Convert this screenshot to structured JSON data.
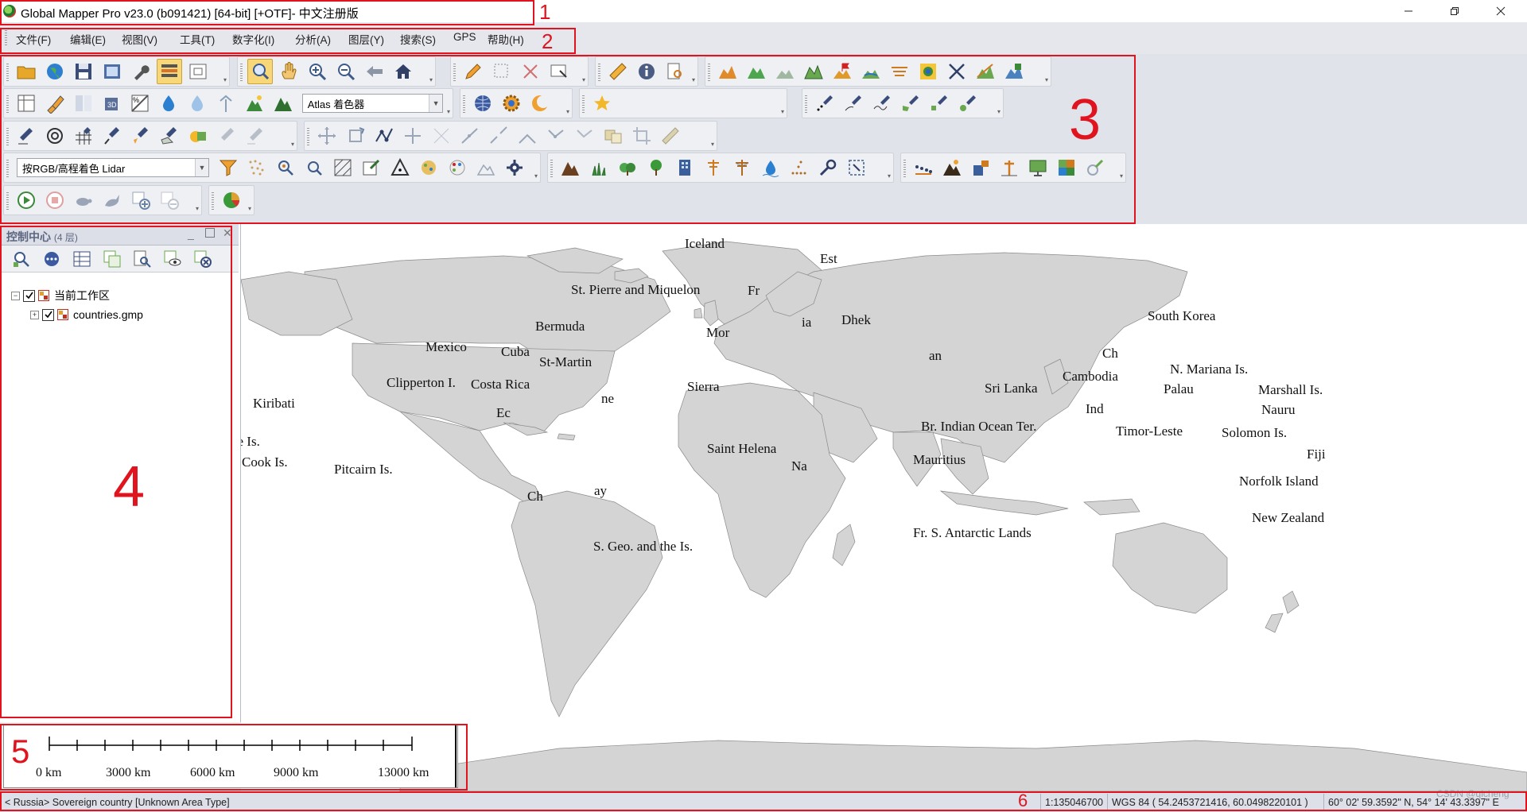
{
  "window": {
    "title": "Global Mapper Pro v23.0 (b091421) [64-bit] [+OTF]- 中文注册版"
  },
  "menu": [
    "文件(F)",
    "编辑(E)",
    "视图(V)",
    "工具(T)",
    "数字化(I)",
    "分析(A)",
    "图层(Y)",
    "搜索(S)",
    "GPS",
    "帮助(H)"
  ],
  "toolbar": {
    "shader_select": "Atlas 着色器",
    "lidar_select": "按RGB/高程着色 Lidar"
  },
  "panel": {
    "title": "控制中心",
    "count": "(4 层)",
    "workspace": "当前工作区",
    "layer": "countries.gmp"
  },
  "map": {
    "labels": [
      "Iceland",
      "Est",
      "St. Pierre and Miquelon",
      "Fr",
      "Bermuda",
      "Mor",
      "Dhek",
      "ia",
      "Ch",
      "South Korea",
      "Cuba",
      "St-Martin",
      "Mexico",
      "Clipperton I.",
      "Costa Rica",
      "Sierra",
      "Ec",
      "ne",
      "Sri Lanka",
      "Cambodia",
      "N. Mariana Is.",
      "Palau",
      "Marshall Is.",
      "Nauru",
      "Kiribati",
      "Br. Indian Ocean Ter.",
      "Timor-Leste",
      "Solomon Is.",
      "Ind",
      "Fiji",
      "Saint Helena",
      "Mauritius",
      "Na",
      "Cook Is.",
      "Pitcairn Is.",
      "Niue Is.",
      "Ch",
      "ay",
      "Norfolk Island",
      "New Zealand",
      "Fr. S. Antarctic Lands",
      "S. Geo. and the Is.",
      "an"
    ]
  },
  "scalebar": {
    "labels": [
      "0 km",
      "3000 km",
      "6000 km",
      "9000 km",
      "13000 km"
    ]
  },
  "status": {
    "feature": "< Russia> Sovereign country [Unknown Area Type]",
    "scale": "1:135046700",
    "coords": "WGS 84 ( 54.2453721416, 60.0498220101 )",
    "dms": "60° 02' 59.3592\" N, 54° 14' 43.3397\" E"
  },
  "annotations": [
    "1",
    "2",
    "3",
    "4",
    "5",
    "6"
  ],
  "watermark": "CSDN @qicheng",
  "colors": {
    "annotation": "#e0141e",
    "land": "#d4d4d4",
    "accent": "#f7d777"
  }
}
